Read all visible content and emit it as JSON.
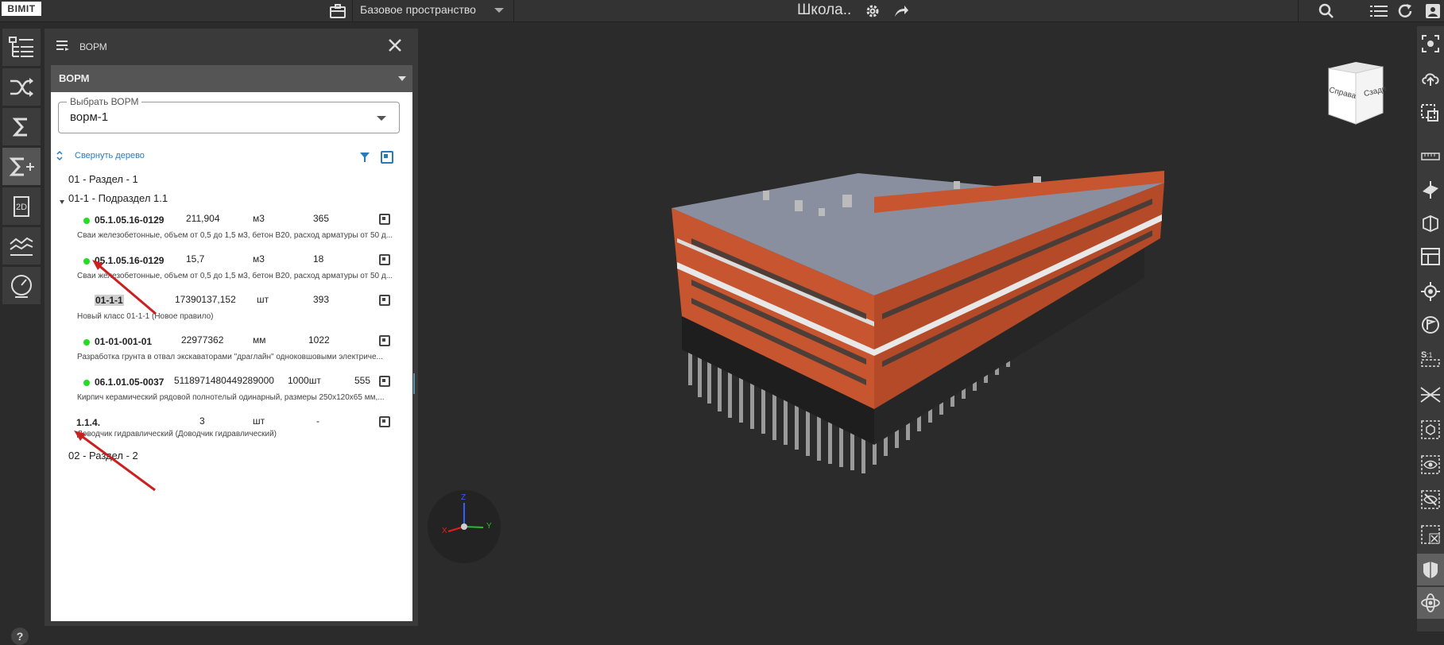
{
  "topbar": {
    "logo": "BIMIT",
    "space": "Базовое пространство",
    "project_title": "Школа..",
    "icons": [
      "briefcase-icon",
      "chevron-down-icon",
      "gear-icon",
      "share-icon",
      "search-icon",
      "list-icon",
      "refresh-icon",
      "user-icon"
    ]
  },
  "left_toolbar": {
    "items": [
      "tree-structure-icon",
      "shuffle-icon",
      "sigma-icon",
      "sigma-plus-icon",
      "2d-drawing-icon",
      "chart-icon",
      "gauge-icon"
    ],
    "active_index": 3,
    "help_label": "?"
  },
  "panel": {
    "title": "ВОРМ",
    "section": "ВОРМ",
    "select_label": "Выбрать ВОРМ",
    "select_value": "ворм-1",
    "collapse_label": "Свернуть дерево",
    "tree": {
      "section1": "01 - Раздел - 1",
      "subsection": "01-1 - Подраздел 1.1",
      "section2": "02 - Раздел - 2"
    },
    "rows": [
      {
        "code": "05.1.05.16-0129",
        "qty": "211,904",
        "unit": "м3",
        "count": "365",
        "desc": "Сваи железобетонные, объем от 0,5 до 1,5 м3, бетон В20, расход арматуры от 50 д...",
        "dot": true
      },
      {
        "code": "05.1.05.16-0129",
        "qty": "15,7",
        "unit": "м3",
        "count": "18",
        "desc": "Сваи железобетонные, объем от 0,5 до 1,5 м3, бетон В20, расход арматуры от 50 д...",
        "dot": true
      },
      {
        "code": "01-1-1",
        "qty": "17390137,152",
        "unit": "шт",
        "count": "393",
        "desc": "Новый класс 01-1-1 (Новое правило)",
        "dot": false
      },
      {
        "code": "01-01-001-01",
        "qty": "22977362",
        "unit": "мм",
        "count": "1022",
        "desc": "Разработка грунта в отвал экскаваторами \"драглайн\" одноковшовыми электриче...",
        "dot": true
      },
      {
        "code": "06.1.01.05-0037",
        "qty": "5118971480449289000",
        "unit": "1000шт",
        "count": "555",
        "desc": "Кирпич керамический рядовой полнотелый одинарный, размеры 250х120х65 мм,...",
        "dot": true
      },
      {
        "code": "1.1.4.",
        "qty": "3",
        "unit": "шт",
        "count": "-",
        "desc": "Доводчик гидравлический (Доводчик гидравлический)",
        "dot": false
      }
    ]
  },
  "navcube": {
    "face_front": "Справа",
    "face_side": "Сзади"
  },
  "axes": {
    "x": "X",
    "y": "Y",
    "z": "Z"
  },
  "colors": {
    "accent": "#2a7ab8",
    "status_green": "#22dd22",
    "brick": "#c7552f",
    "annotation_arrow": "#cc1f1f"
  },
  "right_toolbar": {
    "items": [
      "focus-icon",
      "cloud-upload-icon",
      "select-box-icon",
      "ruler-icon",
      "section-plane-icon",
      "section-box-icon",
      "layout-icon",
      "target-icon",
      "flag-icon",
      "scale-icon",
      "crossed-lines-icon",
      "cube-dashed-icon",
      "eye-icon",
      "eye-off-icon",
      "close-box-icon",
      "shield-cube-icon",
      "orbit-icon"
    ]
  }
}
